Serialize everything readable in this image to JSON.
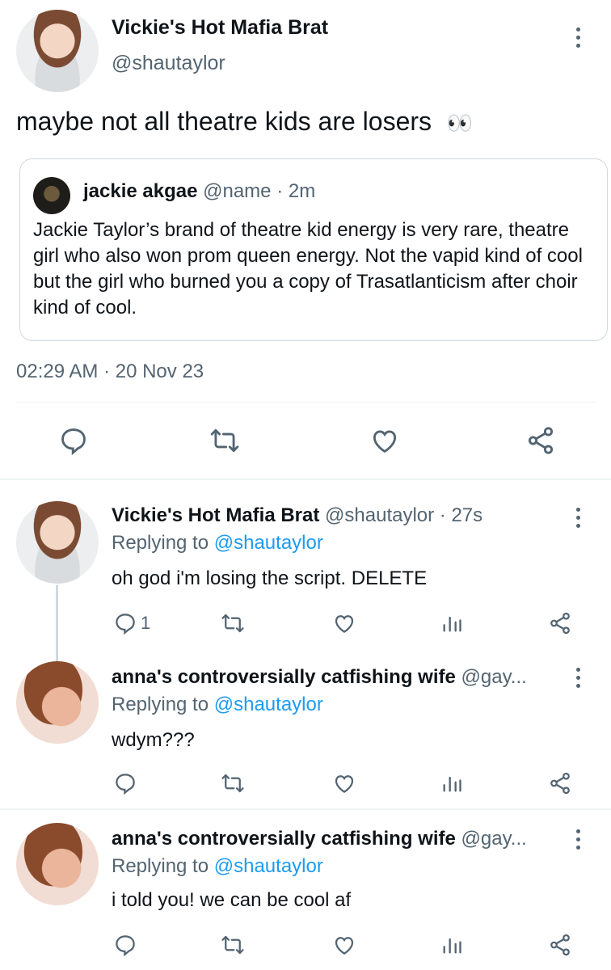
{
  "main_tweet": {
    "display_name": "Vickie's Hot Mafia Brat",
    "handle": "@shautaylor",
    "text": "maybe not all theatre kids are losers",
    "emoji": "👀",
    "timestamp": "02:29 AM · 20 Nov 23",
    "quoted": {
      "display_name": "jackie akgae",
      "handle": "@name",
      "time": "· 2m",
      "text": "Jackie Taylor’s brand of theatre kid energy is very rare, theatre girl who also won prom queen energy. Not the vapid kind of cool but the girl who burned you a copy of Trasatlanticism after choir kind of cool."
    }
  },
  "replies": [
    {
      "display_name": "Vickie's Hot Mafia Brat",
      "handle": "@shautaylor · 27s",
      "replying_prefix": "Replying to",
      "replying_handle": "@shautaylor",
      "text": "oh god i'm losing the script. DELETE",
      "reply_count": "1"
    },
    {
      "display_name": "anna's controversially catfishing wife",
      "handle": "@gay...",
      "replying_prefix": "Replying to",
      "replying_handle": "@shautaylor",
      "text": "wdym???"
    },
    {
      "display_name": "anna's controversially catfishing wife",
      "handle": "@gay...",
      "replying_prefix": "Replying to",
      "replying_handle": "@shautaylor",
      "text": "i told you! we can be cool af"
    }
  ],
  "colors": {
    "text": "#0f1419",
    "secondary": "#536471",
    "accent": "#1d9bf0",
    "divider": "#eff3f4"
  },
  "icons": [
    "reply-icon",
    "retweet-icon",
    "like-icon",
    "share-icon",
    "views-icon",
    "more-icon"
  ]
}
